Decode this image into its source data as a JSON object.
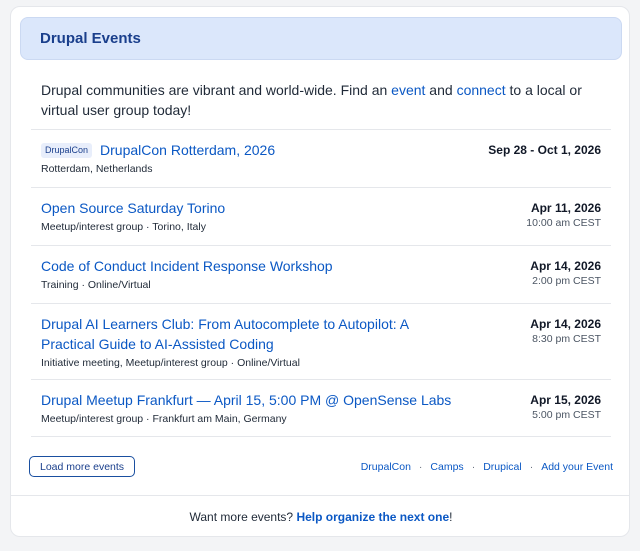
{
  "header": {
    "title": "Drupal Events"
  },
  "intro": {
    "text_before": "Drupal communities are vibrant and world-wide. Find an ",
    "link_event": "event",
    "text_middle": " and ",
    "link_connect": "connect",
    "text_after": " to a local or virtual user group today!"
  },
  "events": [
    {
      "tag": "DrupalCon",
      "title": "DrupalCon Rotterdam, 2026",
      "meta": "Rotterdam, Netherlands",
      "date": "Sep 28 - Oct 1, 2026",
      "time": ""
    },
    {
      "tag": "",
      "title": "Open Source Saturday Torino",
      "meta": "Meetup/interest group · Torino, Italy",
      "date": "Apr 11, 2026",
      "time": "10:00 am CEST"
    },
    {
      "tag": "",
      "title": "Code of Conduct Incident Response Workshop",
      "meta": "Training · Online/Virtual",
      "date": "Apr 14, 2026",
      "time": "2:00 pm CEST"
    },
    {
      "tag": "",
      "title": "Drupal AI Learners Club: From Autocomplete to Autopilot: A Practical Guide to AI-Assisted Coding",
      "meta": "Initiative meeting, Meetup/interest group · Online/Virtual",
      "date": "Apr 14, 2026",
      "time": "8:30 pm CEST"
    },
    {
      "tag": "",
      "title": "Drupal Meetup Frankfurt — April 15, 5:00 PM @ OpenSense Labs",
      "meta": "Meetup/interest group · Frankfurt am Main, Germany",
      "date": "Apr 15, 2026",
      "time": "5:00 pm CEST"
    }
  ],
  "actions": {
    "load_more": "Load more events",
    "links": [
      "DrupalCon",
      "Camps",
      "Drupical",
      "Add your Event"
    ],
    "separator": "·"
  },
  "bottom": {
    "text_before": "Want more events? ",
    "link": "Help organize the next one",
    "text_after": "!"
  }
}
